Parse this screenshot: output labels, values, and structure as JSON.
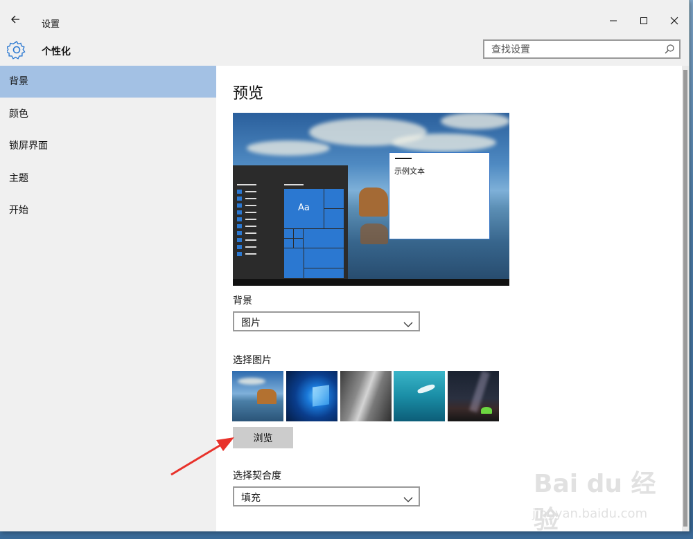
{
  "window": {
    "title": "设置",
    "back_icon": "back-arrow-icon",
    "controls": [
      "minimize-icon",
      "maximize-icon",
      "close-icon"
    ]
  },
  "header": {
    "section_title": "个性化",
    "section_icon": "gear-icon",
    "search": {
      "placeholder": "查找设置",
      "icon": "search-icon"
    }
  },
  "sidebar": {
    "items": [
      {
        "label": "背景",
        "active": true
      },
      {
        "label": "颜色",
        "active": false
      },
      {
        "label": "锁屏界面",
        "active": false
      },
      {
        "label": "主题",
        "active": false
      },
      {
        "label": "开始",
        "active": false
      }
    ]
  },
  "main": {
    "preview_heading": "预览",
    "preview_sample_text": "示例文本",
    "preview_tile_text": "Aa",
    "background": {
      "label": "背景",
      "value": "图片"
    },
    "choose_picture": {
      "label": "选择图片",
      "browse_label": "浏览"
    },
    "fit": {
      "label": "选择契合度",
      "value": "填充"
    }
  },
  "watermark": {
    "brand": "Bai du 经验",
    "url": "jingyan.baidu.com"
  },
  "colors": {
    "accent": "#2b78d1",
    "nav_active": "#a3c1e4",
    "chrome": "#f0f0f0",
    "annotation_arrow": "#e8322b"
  }
}
